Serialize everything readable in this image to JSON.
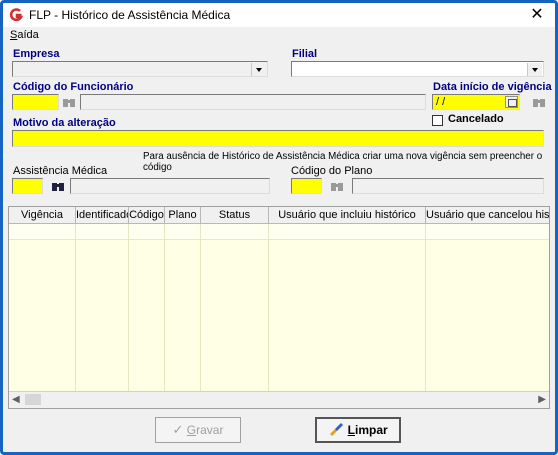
{
  "window": {
    "title": "FLP - Histórico de Assistência Médica",
    "close_glyph": "✕"
  },
  "menu": {
    "first_letter": "S",
    "rest": "aída"
  },
  "empresa": {
    "label": "Empresa",
    "value": ""
  },
  "filial": {
    "label": "Filial",
    "value": ""
  },
  "funcionario": {
    "label": "Código do Funcionário",
    "code": "",
    "name": ""
  },
  "vigencia": {
    "label": "Data início de vigência",
    "value": " / /"
  },
  "cancelado": {
    "label": "Cancelado",
    "checked": false
  },
  "motivo": {
    "label": "Motivo da alteração",
    "value": ""
  },
  "hint": "Para ausência de Histórico de Assistência Médica criar uma nova vigência sem preencher o código",
  "assistencia": {
    "label": "Assistência Médica",
    "code": "",
    "name": ""
  },
  "plano": {
    "label": "Código do Plano",
    "code": "",
    "name": ""
  },
  "grid": {
    "columns": [
      "Vigência",
      "Identificador",
      "Código",
      "Plano",
      "Status",
      "Usuário que incluiu histórico",
      "Usuário que cancelou histórico"
    ],
    "rows": []
  },
  "buttons": {
    "gravar": {
      "first_letter": "G",
      "rest": "ravar",
      "enabled": false
    },
    "limpar": {
      "first_letter": "L",
      "rest": "impar",
      "enabled": true
    }
  },
  "colors": {
    "required_field": "#ffff00",
    "label_blue": "#000080",
    "frame_border": "#1565c0",
    "grid_bg": "#ffffe6"
  }
}
